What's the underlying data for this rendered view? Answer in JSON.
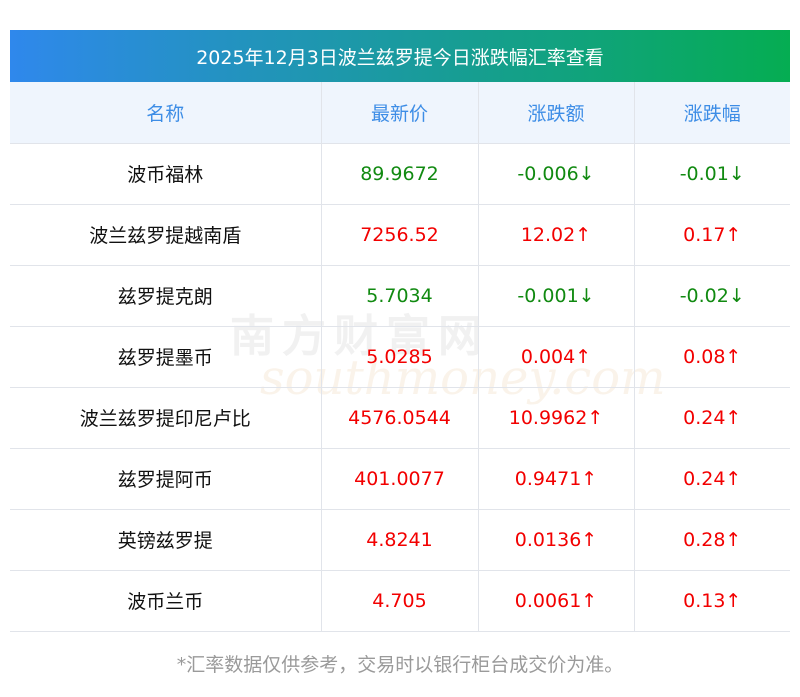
{
  "title": "2025年12月3日波兰兹罗提今日涨跌幅汇率查看",
  "headers": [
    "名称",
    "最新价",
    "涨跌额",
    "涨跌幅"
  ],
  "rows": [
    {
      "name": "波币福林",
      "price": "89.9672",
      "change": "-0.006↓",
      "pct": "-0.01↓",
      "dir": "down"
    },
    {
      "name": "波兰兹罗提越南盾",
      "price": "7256.52",
      "change": "12.02↑",
      "pct": "0.17↑",
      "dir": "up"
    },
    {
      "name": "兹罗提克朗",
      "price": "5.7034",
      "change": "-0.001↓",
      "pct": "-0.02↓",
      "dir": "down"
    },
    {
      "name": "兹罗提墨币",
      "price": "5.0285",
      "change": "0.004↑",
      "pct": "0.08↑",
      "dir": "up"
    },
    {
      "name": "波兰兹罗提印尼卢比",
      "price": "4576.0544",
      "change": "10.9962↑",
      "pct": "0.24↑",
      "dir": "up"
    },
    {
      "name": "兹罗提阿币",
      "price": "401.0077",
      "change": "0.9471↑",
      "pct": "0.24↑",
      "dir": "up"
    },
    {
      "name": "英镑兹罗提",
      "price": "4.8241",
      "change": "0.0136↑",
      "pct": "0.28↑",
      "dir": "up"
    },
    {
      "name": "波币兰币",
      "price": "4.705",
      "change": "0.0061↑",
      "pct": "0.13↑",
      "dir": "up"
    }
  ],
  "footer": "*汇率数据仅供参考，交易时以银行柜台成交价为准。",
  "watermark": {
    "cn": "南方财富网",
    "en": "southmoney.com"
  },
  "colors": {
    "up": "#f20000",
    "down": "#118a11",
    "header_text": "#3d8de6"
  }
}
